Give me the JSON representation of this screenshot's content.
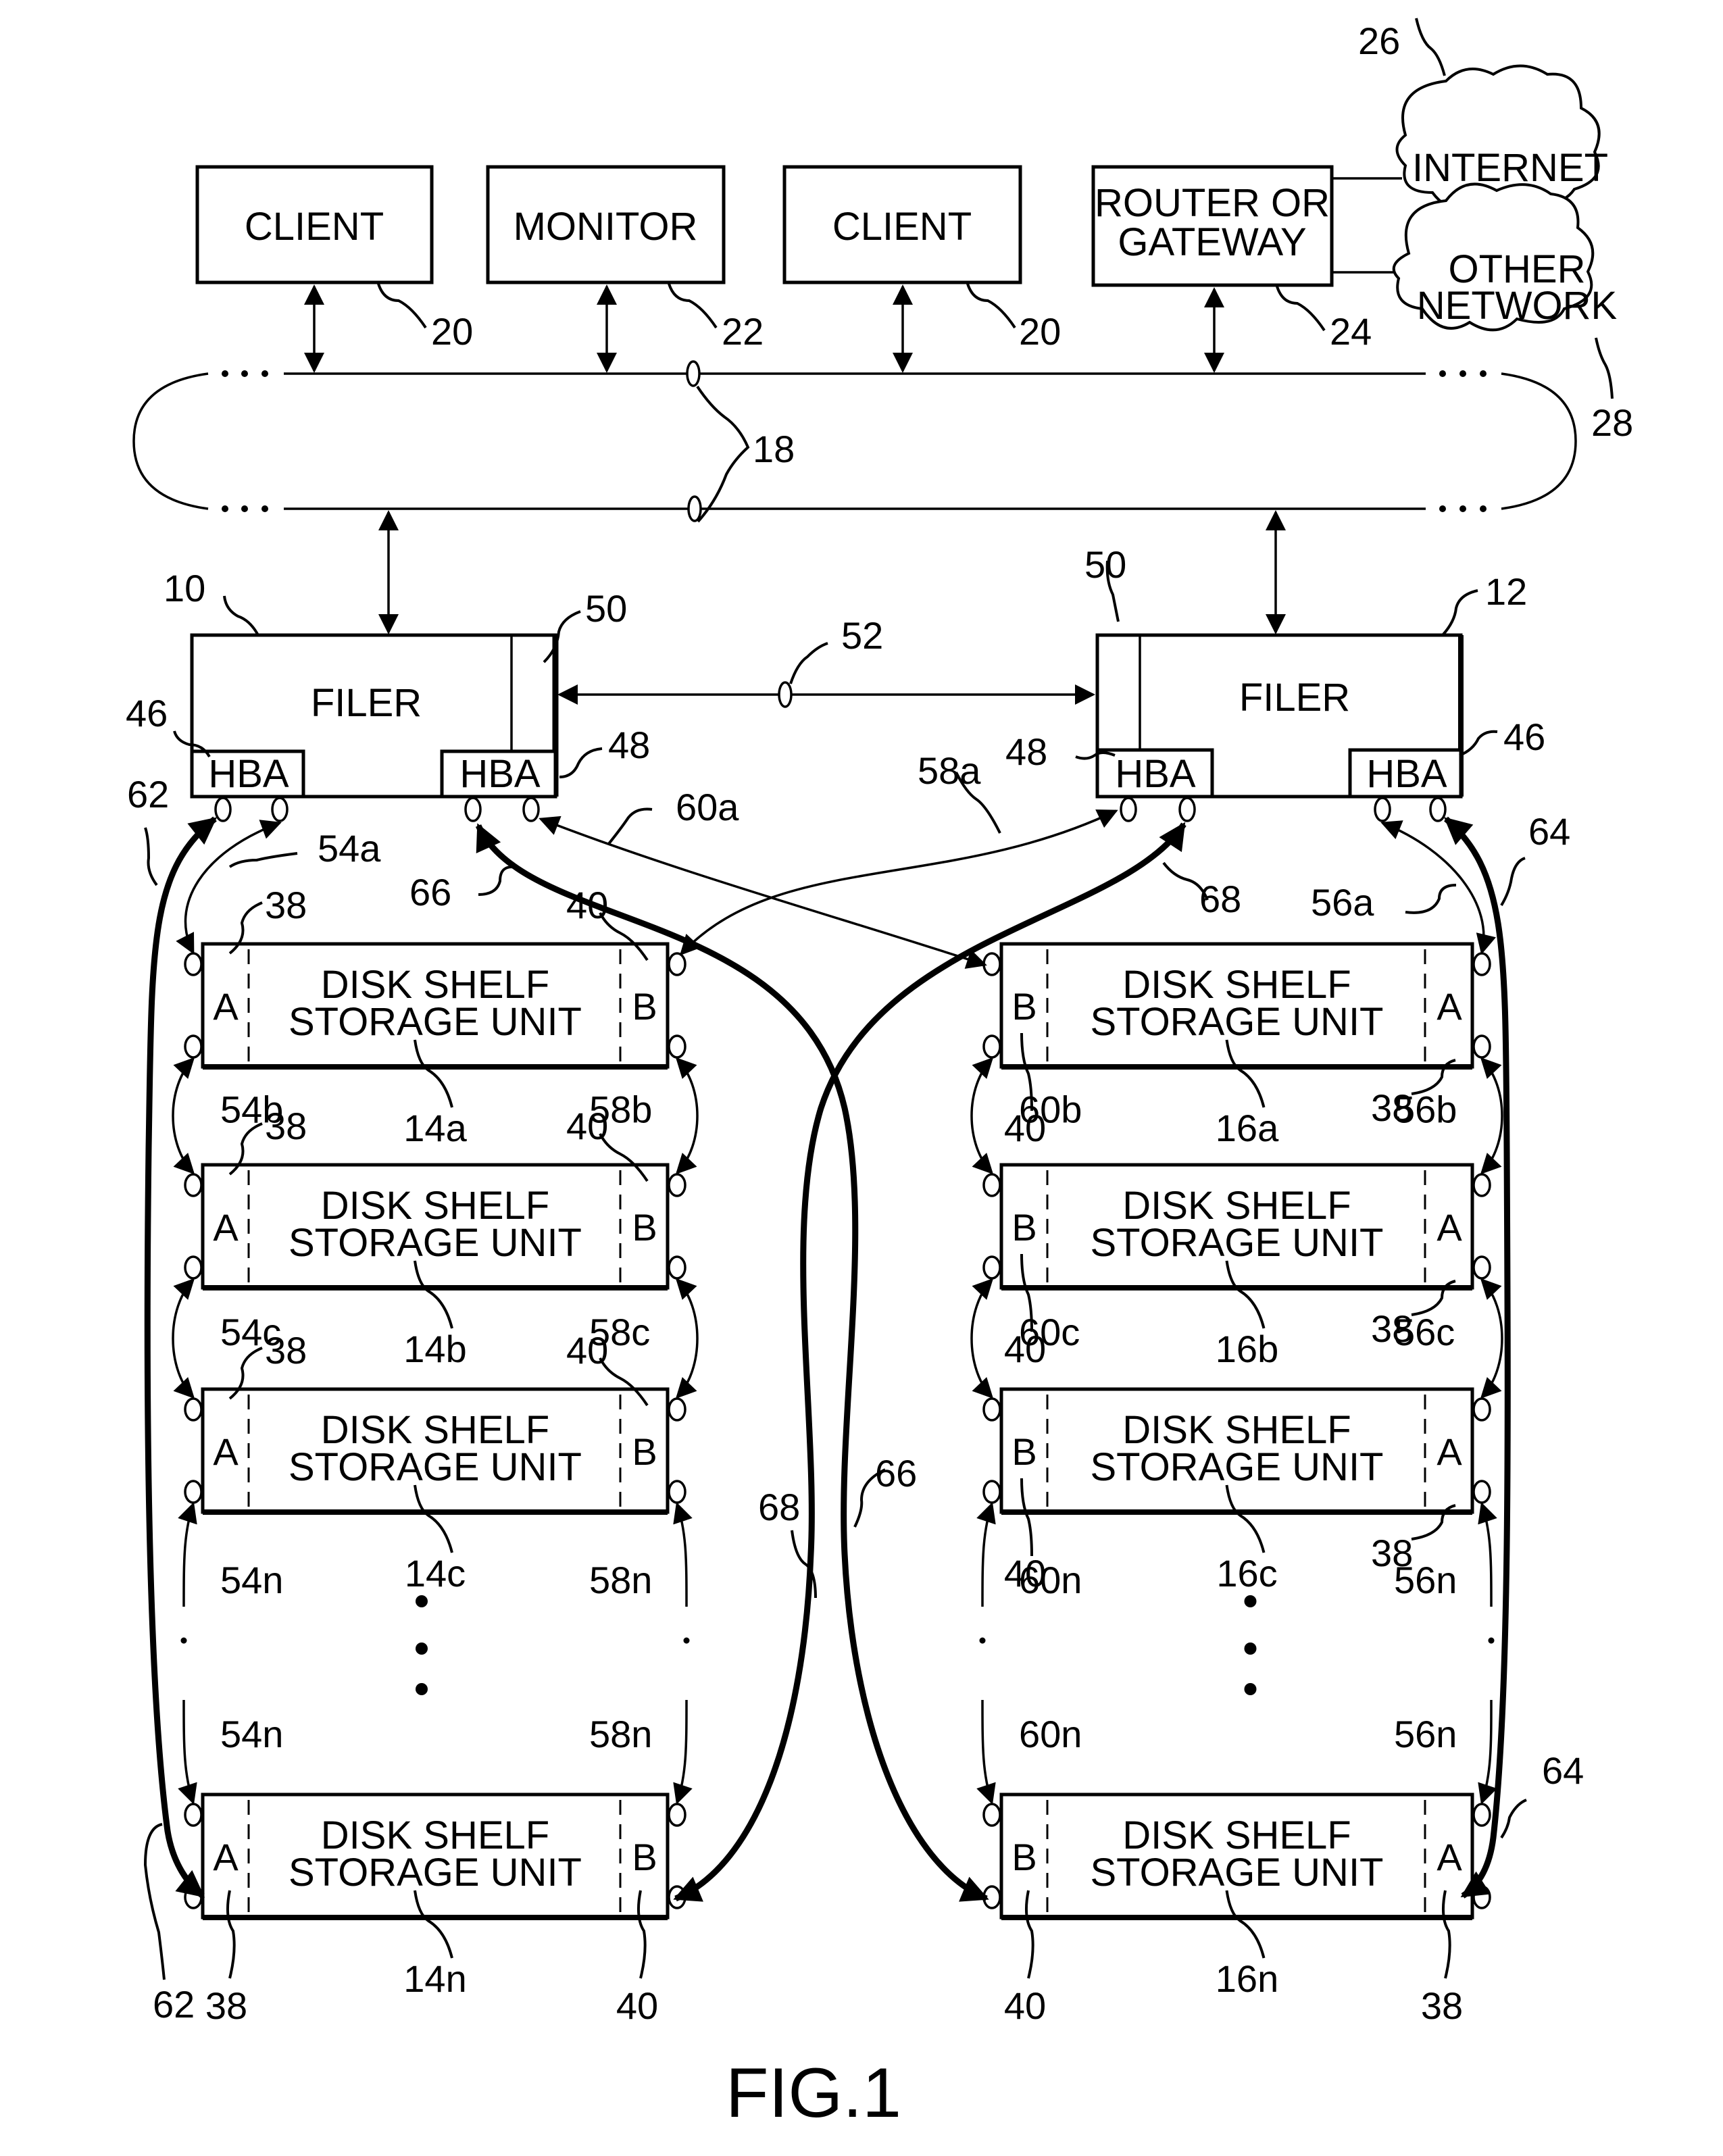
{
  "figure": {
    "caption": "FIG.1",
    "network": {
      "nodes": [
        {
          "id": "client-left",
          "label": "CLIENT",
          "ref": "20"
        },
        {
          "id": "monitor",
          "label": "MONITOR",
          "ref": "22"
        },
        {
          "id": "client-right",
          "label": "CLIENT",
          "ref": "20"
        },
        {
          "id": "router",
          "label_line1": "ROUTER OR",
          "label_line2": "GATEWAY",
          "ref": "24"
        }
      ],
      "clouds": [
        {
          "id": "internet",
          "label": "INTERNET",
          "ref": "26"
        },
        {
          "id": "other-network",
          "label_line1": "OTHER",
          "label_line2": "NETWORK",
          "ref": "28"
        }
      ],
      "bus_ref": "18",
      "ellipsis": "..."
    },
    "filers": [
      {
        "id": "filer-left",
        "label": "FILER",
        "ref": "10",
        "panel_ref": "50",
        "hba_left": {
          "label": "HBA",
          "ref": "46"
        },
        "hba_right": {
          "label": "HBA",
          "ref": "48"
        }
      },
      {
        "id": "filer-right",
        "label": "FILER",
        "ref": "12",
        "panel_ref": "50",
        "hba_left": {
          "label": "HBA",
          "ref": "48"
        },
        "hba_right": {
          "label": "HBA",
          "ref": "46"
        }
      }
    ],
    "interconnect_ref": "52",
    "shelf_label_line1": "DISK SHELF",
    "shelf_label_line2": "STORAGE UNIT",
    "left_column": {
      "port_left": "A",
      "port_right": "B",
      "shelves": [
        {
          "ref": "14a",
          "ref_a": "38",
          "ref_b": "40"
        },
        {
          "ref": "14b",
          "ref_a": "38",
          "ref_b": "40"
        },
        {
          "ref": "14c",
          "ref_a": "38",
          "ref_b": "40"
        },
        {
          "ref": "14n",
          "ref_a": "38",
          "ref_b": "40"
        }
      ],
      "loop_a_refs": [
        "54a",
        "54b",
        "54c",
        "54n",
        "54n"
      ],
      "loop_b_refs": [
        "58a",
        "58b",
        "58c",
        "58n",
        "58n"
      ],
      "outer_ref": "62"
    },
    "right_column": {
      "port_left": "B",
      "port_right": "A",
      "shelves": [
        {
          "ref": "16a",
          "ref_a": "38",
          "ref_b": "40"
        },
        {
          "ref": "16b",
          "ref_a": "38",
          "ref_b": "40"
        },
        {
          "ref": "16c",
          "ref_a": "38",
          "ref_b": "40"
        },
        {
          "ref": "16n",
          "ref_a": "38",
          "ref_b": "40"
        }
      ],
      "loop_a_refs": [
        "56a",
        "56b",
        "56c",
        "56n",
        "56n"
      ],
      "loop_b_refs": [
        "60a",
        "60b",
        "60c",
        "60n",
        "60n"
      ],
      "outer_ref": "64"
    },
    "cross_refs": {
      "thick_left": "66",
      "thick_right": "68"
    }
  }
}
